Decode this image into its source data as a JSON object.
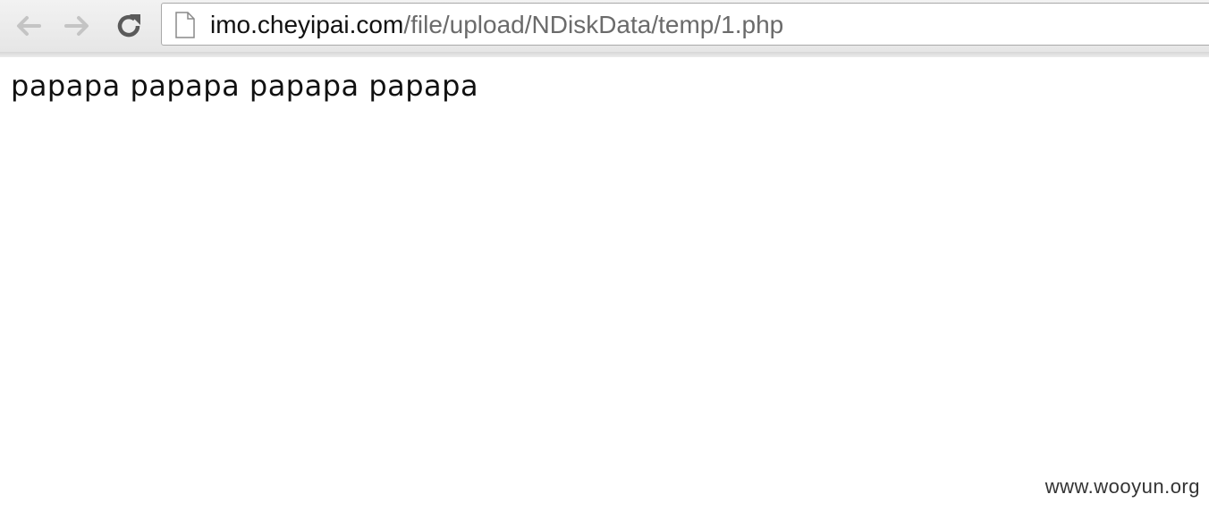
{
  "browser": {
    "url_host": "imo.cheyipai.com",
    "url_path": "/file/upload/NDiskData/temp/1.php",
    "icons": {
      "back": "back-arrow-icon",
      "forward": "forward-arrow-icon",
      "reload": "reload-icon",
      "page": "page-icon"
    }
  },
  "page": {
    "body_text": "papapa papapa papapa papapa"
  },
  "watermark": "www.wooyun.org"
}
